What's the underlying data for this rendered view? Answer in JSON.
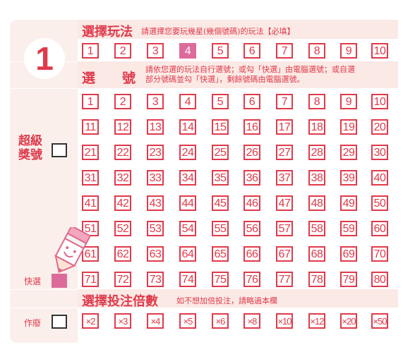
{
  "ticket_number": "1",
  "section_play": {
    "title": "選擇玩法",
    "note": "請選擇您要玩幾星(幾個號碼)的玩法【必填】",
    "options": [
      "1",
      "2",
      "3",
      "4",
      "5",
      "6",
      "7",
      "8",
      "9",
      "10"
    ],
    "selected": "4"
  },
  "section_numbers": {
    "title_left": "選",
    "title_right": "號",
    "note_line1": "請依您選的玩法自行選號；或勾「快選」由電腦選號；或自選",
    "note_line2": "部分號碼並勾「快選」，剩餘號碼由電腦選號。",
    "numbers": [
      "1",
      "2",
      "3",
      "4",
      "5",
      "6",
      "7",
      "8",
      "9",
      "10",
      "11",
      "12",
      "13",
      "14",
      "15",
      "16",
      "17",
      "18",
      "19",
      "20",
      "21",
      "22",
      "23",
      "24",
      "25",
      "26",
      "27",
      "28",
      "29",
      "30",
      "31",
      "32",
      "33",
      "34",
      "35",
      "36",
      "37",
      "38",
      "39",
      "40",
      "41",
      "42",
      "43",
      "44",
      "45",
      "46",
      "47",
      "48",
      "49",
      "50",
      "51",
      "52",
      "53",
      "54",
      "55",
      "56",
      "57",
      "58",
      "59",
      "60",
      "61",
      "62",
      "63",
      "64",
      "65",
      "66",
      "67",
      "68",
      "69",
      "70",
      "71",
      "72",
      "73",
      "74",
      "75",
      "76",
      "77",
      "78",
      "79",
      "80"
    ]
  },
  "super_bonus": {
    "line1": "超級",
    "line2": "獎號"
  },
  "quick_pick": {
    "label": "快選",
    "checked": true
  },
  "section_multiplier": {
    "title": "選擇投注倍數",
    "note": "如不想加倍投注，請略過本欄",
    "options": [
      "×2",
      "×3",
      "×4",
      "×5",
      "×6",
      "×8",
      "×10",
      "×12",
      "×20",
      "×50"
    ]
  },
  "void": {
    "label": "作廢"
  },
  "colors": {
    "accent": "#e03a4b",
    "selected": "#dc6b9b",
    "panel": "#fbefeb"
  }
}
